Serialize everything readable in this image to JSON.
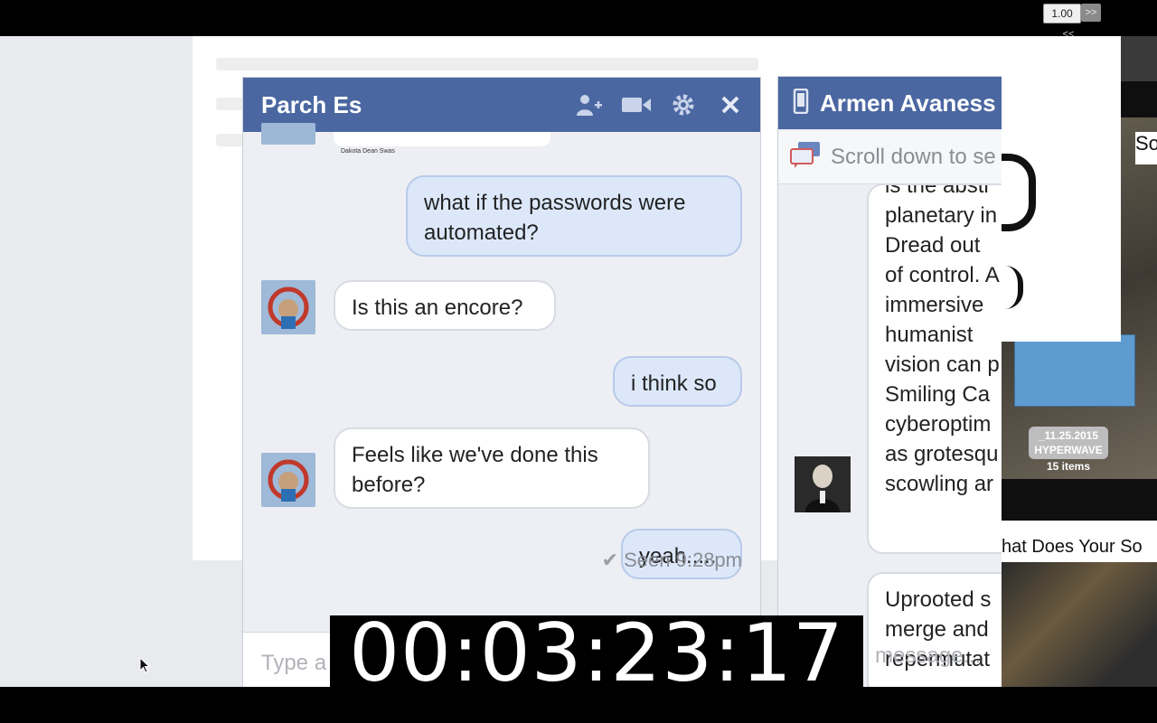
{
  "player": {
    "speed": "1.00",
    "forward_label": ">>",
    "back_label": "<<"
  },
  "timer": "00:03:23:17",
  "chat1": {
    "title": "Parch Es",
    "icons": [
      "add-friend-icon",
      "video-call-icon",
      "gear-icon",
      "close-icon"
    ],
    "partial_caption": "Dakota Dean Swas",
    "messages": [
      {
        "side": "out",
        "text": "what if the passwords were automated?"
      },
      {
        "side": "in",
        "text": "Is this an encore?"
      },
      {
        "side": "out",
        "text": "i think so"
      },
      {
        "side": "in",
        "text": "Feels like we've done this before?"
      },
      {
        "side": "out",
        "text": "yeah....."
      }
    ],
    "seen": "Seen 9:28pm",
    "input_placeholder": "Type a"
  },
  "chat2": {
    "title": "Armen Avaness",
    "notice": "Scroll down to se",
    "message1_lines": [
      "is the abstr",
      "planetary in",
      "Dread out",
      "of control. A",
      "immersive",
      "humanist",
      "vision can p",
      "Smiling Ca",
      "cyberoptim",
      "as grotesqu",
      "scowling ar"
    ],
    "message2_lines": [
      "Uprooted s",
      "merge and",
      "repermutat"
    ],
    "input_placeholder": "message..."
  },
  "side_panel": {
    "date_badge": "_11.25.2015",
    "badge_title": "HYPERWAVE",
    "items_count": "15 items",
    "strip_text": "hat Does Your So",
    "top_label": "So"
  }
}
